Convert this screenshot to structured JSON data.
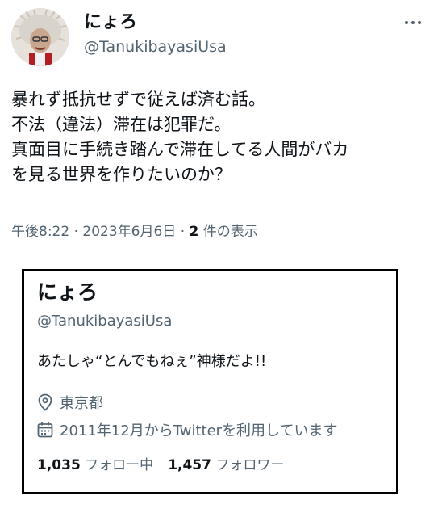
{
  "tweet": {
    "author": {
      "name": "にょろ",
      "handle": "@TanukibayasiUsa"
    },
    "text_lines": [
      "暴れず抵抗せずで従えば済む話。",
      "不法（違法）滞在は犯罪だ。",
      "真面目に手続き踏んで滞在してる人間がバカ",
      "を見る世界を作りたいのか？"
    ],
    "time": "午後8:22",
    "separator": " · ",
    "date": "2023年6月6日",
    "view_count": "2",
    "view_suffix": " 件の表示"
  },
  "profile_card": {
    "name": "にょろ",
    "handle": "@TanukibayasiUsa",
    "bio": "あたしゃ“とんでもねぇ”神様だよ!!",
    "location": "東京都",
    "joined": "2011年12月からTwitterを利用しています",
    "following_count": "1,035",
    "following_label": " フォロー中",
    "followers_count": "1,457",
    "followers_label": " フォロワー"
  },
  "icons": {
    "more": "more-dots-icon",
    "location": "location-pin-icon",
    "calendar": "calendar-icon"
  },
  "colors": {
    "text": "#0f1419",
    "secondary": "#536471",
    "card_border": "#000000"
  }
}
